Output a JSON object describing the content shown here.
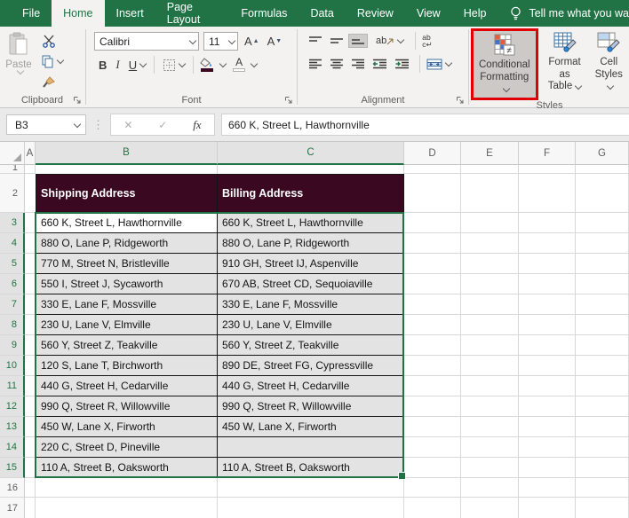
{
  "colors": {
    "ribbon_green": "#217346",
    "table_header_fill": "#3a0921",
    "highlight_red": "#e00000",
    "selection_fill": "#e3e3e3"
  },
  "tabs": [
    "File",
    "Home",
    "Insert",
    "Page Layout",
    "Formulas",
    "Data",
    "Review",
    "View",
    "Help"
  ],
  "active_tab": "Home",
  "tell_me": "Tell me what you wa",
  "ribbon": {
    "clipboard": {
      "group_label": "Clipboard",
      "paste": "Paste"
    },
    "font": {
      "group_label": "Font",
      "font_name": "Calibri",
      "font_size": "11",
      "bold": "B",
      "italic": "I",
      "underline": "U",
      "grow_font": "A",
      "shrink_font": "A",
      "font_color": "A"
    },
    "alignment": {
      "group_label": "Alignment",
      "orientation_glyph": "ab",
      "wrap_glyph_top": "ab",
      "wrap_glyph_bottom": "c"
    },
    "styles": {
      "group_label": "Styles",
      "conditional_formatting_line1": "Conditional",
      "conditional_formatting_line2": "Formatting",
      "format_as_table_line1": "Format as",
      "format_as_table_line2": "Table",
      "cell_styles_line1": "Cell",
      "cell_styles_line2": "Styles",
      "not_equal_badge": "≠"
    }
  },
  "formula_bar": {
    "name_box": "B3",
    "cancel_glyph": "✕",
    "enter_glyph": "✓",
    "fx_label": "fx",
    "formula": "660 K, Street L, Hawthornville"
  },
  "sheet": {
    "column_headers": [
      "A",
      "B",
      "C",
      "D",
      "E",
      "F",
      "G"
    ],
    "selected_columns": [
      "B",
      "C"
    ],
    "partial_top_row": "1",
    "header_row": {
      "number": "2",
      "shipping_header": "Shipping Address",
      "billing_header": "Billing Address"
    },
    "rows": [
      {
        "n": "3",
        "shipping": "660 K, Street L, Hawthornville",
        "billing": "660 K, Street L, Hawthornville",
        "active": true
      },
      {
        "n": "4",
        "shipping": "880 O, Lane P, Ridgeworth",
        "billing": "880 O, Lane P, Ridgeworth"
      },
      {
        "n": "5",
        "shipping": "770 M, Street N, Bristleville",
        "billing": "910 GH, Street IJ, Aspenville"
      },
      {
        "n": "6",
        "shipping": "550 I, Street J, Sycaworth",
        "billing": "670 AB, Street CD, Sequoiaville"
      },
      {
        "n": "7",
        "shipping": "330 E, Lane F, Mossville",
        "billing": "330 E, Lane F, Mossville"
      },
      {
        "n": "8",
        "shipping": "230 U, Lane V, Elmville",
        "billing": "230 U, Lane V, Elmville"
      },
      {
        "n": "9",
        "shipping": "560 Y, Street Z, Teakville",
        "billing": "560 Y, Street Z, Teakville"
      },
      {
        "n": "10",
        "shipping": "120 S, Lane T, Birchworth",
        "billing": "890 DE, Street FG, Cypressville"
      },
      {
        "n": "11",
        "shipping": "440 G, Street H, Cedarville",
        "billing": "440 G, Street H, Cedarville"
      },
      {
        "n": "12",
        "shipping": "990 Q, Street R, Willowville",
        "billing": "990 Q, Street R, Willowville"
      },
      {
        "n": "13",
        "shipping": "450 W, Lane X, Firworth",
        "billing": "450 W, Lane X, Firworth"
      },
      {
        "n": "14",
        "shipping": "220 C, Street D, Pineville",
        "billing": ""
      },
      {
        "n": "15",
        "shipping": "110 A, Street B, Oaksworth",
        "billing": "110 A, Street B, Oaksworth"
      }
    ],
    "trailing_rows": [
      "16",
      "17"
    ]
  }
}
